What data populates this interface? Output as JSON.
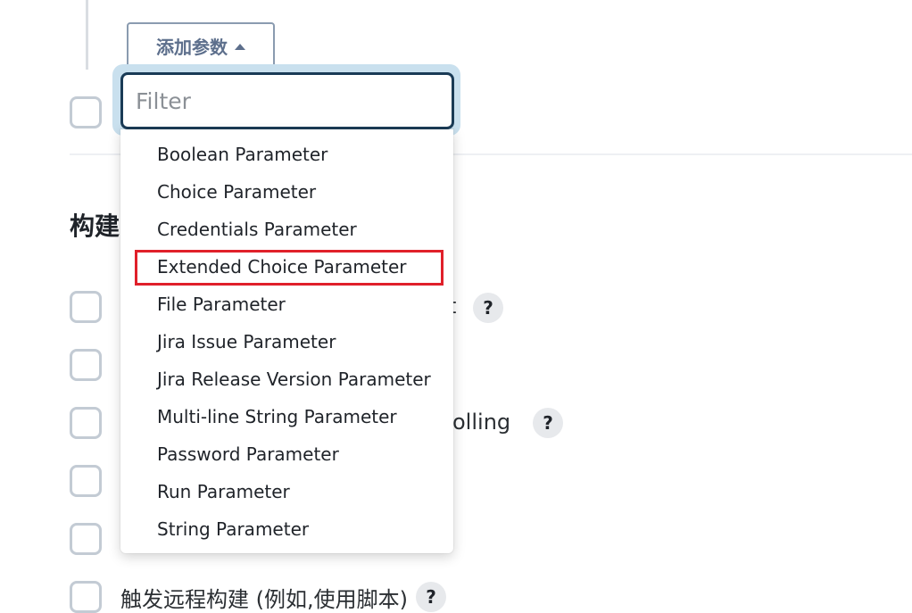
{
  "add_parameter_button": {
    "label": "添加参数"
  },
  "filter": {
    "placeholder": "Filter",
    "value": ""
  },
  "dropdown": {
    "items": [
      "Boolean Parameter",
      "Choice Parameter",
      "Credentials Parameter",
      "Extended Choice Parameter",
      "File Parameter",
      "Jira Issue Parameter",
      "Jira Release Version Parameter",
      "Multi-line String Parameter",
      "Password Parameter",
      "Run Parameter",
      "String Parameter"
    ],
    "highlighted_index": 3
  },
  "section": {
    "title": "构建"
  },
  "background_text": {
    "row1_tail": "t",
    "row3_tail": "olling",
    "row7": "触发远程构建 (例如,使用脚本)"
  },
  "help_icon_glyph": "?",
  "colors": {
    "highlight_border": "#e0202a",
    "filter_border": "#1a3b56",
    "button_text": "#5d6f8c"
  }
}
